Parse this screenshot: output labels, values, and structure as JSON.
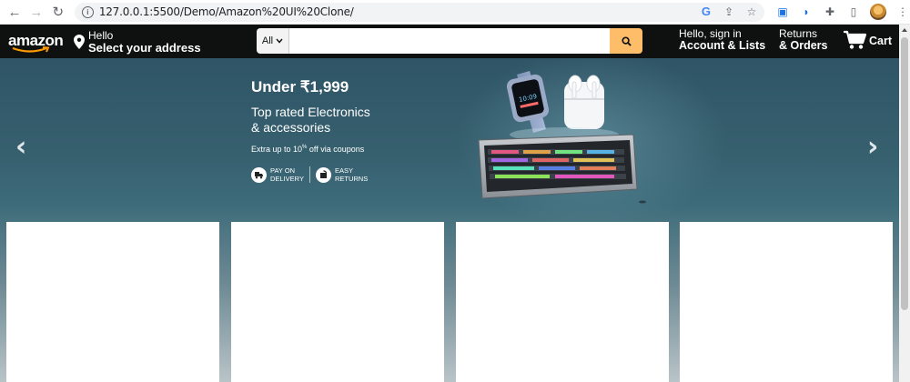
{
  "browser": {
    "url": "127.0.0.1:5500/Demo/Amazon%20UI%20Clone/",
    "nav_icons": [
      "back-arrow-icon",
      "forward-arrow-icon",
      "reload-icon"
    ],
    "omnibox_icons": [
      "google-lens-icon",
      "share-icon",
      "bookmark-star-icon"
    ],
    "extension_icons": [
      "screen-cast-icon",
      "extension-drop-icon",
      "puzzle-icon",
      "sidebar-icon",
      "profile-avatar",
      "kebab-menu-icon"
    ]
  },
  "navbar": {
    "logo_text": "amazon",
    "address_hello": "Hello",
    "address_select": "Select your address",
    "search_category": "All",
    "search_value": "",
    "search_placeholder": "",
    "account_line1": "Hello, sign in",
    "account_line2": "Account & Lists",
    "returns_line1": "Returns",
    "returns_line2": "& Orders",
    "cart_label": "Cart"
  },
  "hero": {
    "title": "Under ₹1,999",
    "subtitle_line1": "Top rated Electronics",
    "subtitle_line2": "& accessories",
    "coupon_prefix": "Extra up to 10",
    "coupon_sup": "%",
    "coupon_suffix": " off via coupons",
    "badge1_line1": "PAY ON",
    "badge1_line2": "DELIVERY",
    "badge2_line1": "EASY",
    "badge2_line2": "RETURNS",
    "arrow_left": "‹",
    "arrow_right": "›"
  },
  "cards": [
    {
      "name": "product-card-1"
    },
    {
      "name": "product-card-2"
    },
    {
      "name": "product-card-3"
    },
    {
      "name": "product-card-4"
    }
  ],
  "colors": {
    "navbar_bg": "#0f1111",
    "search_button": "#febd69",
    "hero_top": "#2f5566",
    "hero_bottom": "#b9c4c8"
  }
}
